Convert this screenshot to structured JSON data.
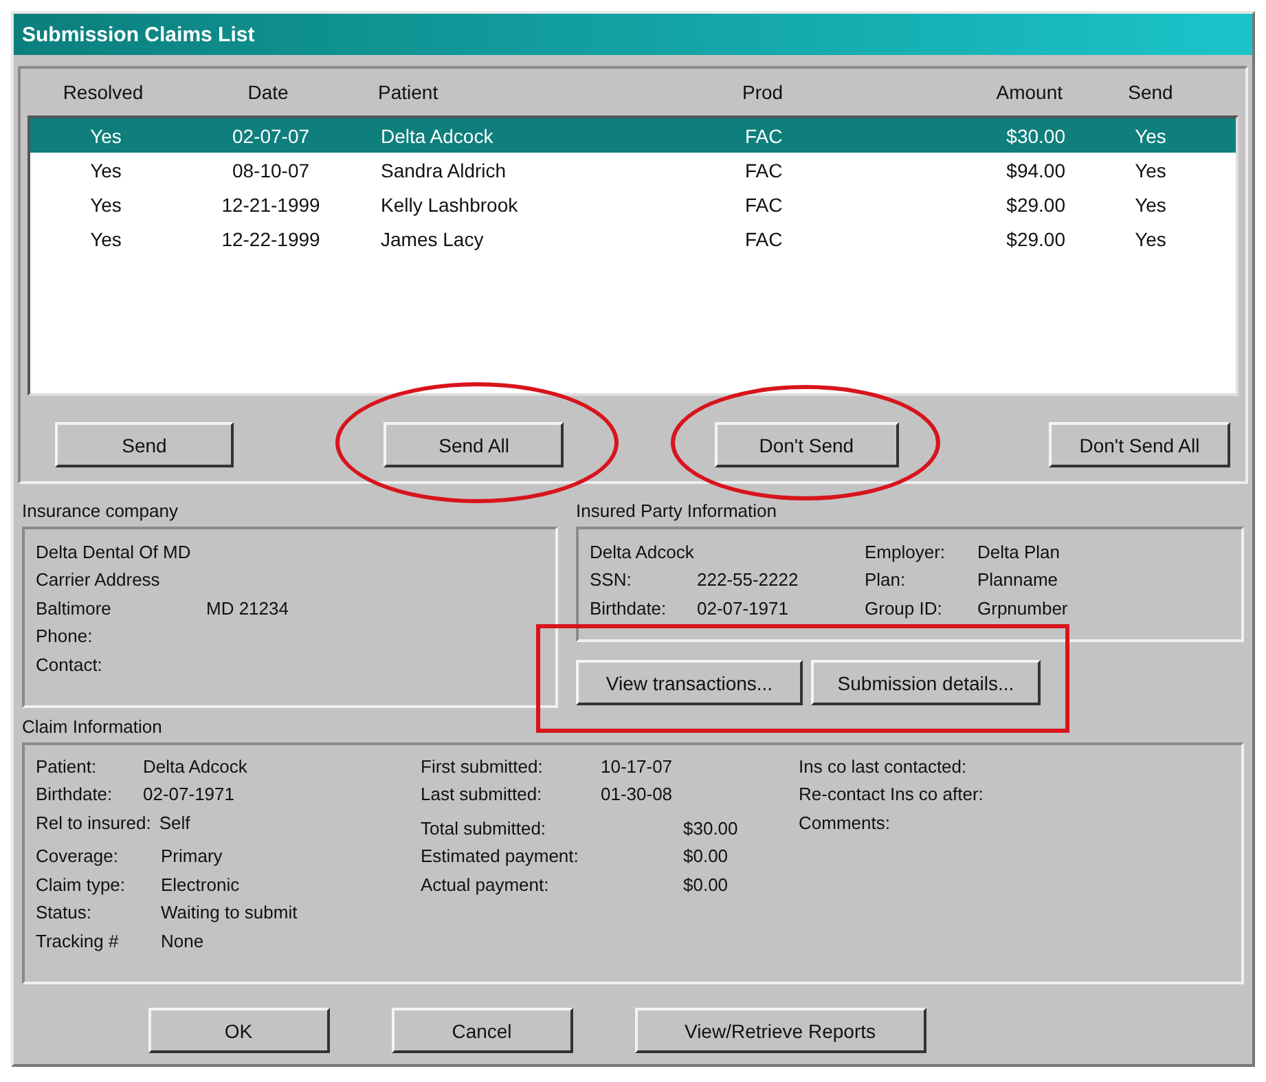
{
  "window": {
    "title": "Submission Claims List"
  },
  "claims_table": {
    "columns": [
      "Resolved",
      "Date",
      "Patient",
      "Prod",
      "Amount",
      "Send"
    ],
    "rows": [
      {
        "cells": [
          "Yes",
          "02-07-07",
          "Delta Adcock",
          "FAC",
          "$30.00",
          "Yes"
        ],
        "selected": true
      },
      {
        "cells": [
          "Yes",
          "08-10-07",
          "Sandra Aldrich",
          "FAC",
          "$94.00",
          "Yes"
        ],
        "selected": false
      },
      {
        "cells": [
          "Yes",
          "12-21-1999",
          "Kelly Lashbrook",
          "FAC",
          "$29.00",
          "Yes"
        ],
        "selected": false
      },
      {
        "cells": [
          "Yes",
          "12-22-1999",
          "James Lacy",
          "FAC",
          "$29.00",
          "Yes"
        ],
        "selected": false
      }
    ]
  },
  "list_buttons": [
    "Send",
    "Send All",
    "Don't Send",
    "Don't Send All"
  ],
  "insurance_company": {
    "heading": "Insurance company",
    "lines": [
      [
        "Delta Dental Of MD"
      ],
      [
        "Carrier Address"
      ],
      [
        "Baltimore",
        "MD  21234"
      ],
      [
        "Phone:"
      ],
      [
        "Contact:"
      ]
    ]
  },
  "insured_party": {
    "heading": "Insured Party Information",
    "left": [
      {
        "value": "Delta Adcock"
      },
      {
        "label": "SSN:",
        "value": "222-55-2222"
      },
      {
        "label": "Birthdate:",
        "value": "02-07-1971"
      }
    ],
    "right": [
      {
        "label": "Employer:",
        "value": "Delta Plan"
      },
      {
        "label": "Plan:",
        "value": "Planname"
      },
      {
        "label": "Group ID:",
        "value": "Grpnumber"
      }
    ],
    "buttons": [
      "View transactions...",
      "Submission details..."
    ]
  },
  "claim_information": {
    "heading": "Claim Information",
    "columns": [
      [
        [
          {
            "label": "Patient:",
            "value": "Delta Adcock"
          },
          {
            "label": "Birthdate:",
            "value": "02-07-1971"
          },
          {
            "label": "Rel to insured:",
            "value": "Self"
          }
        ],
        [
          {
            "label": "Coverage:",
            "value": "Primary"
          },
          {
            "label": "Claim type:",
            "value": "Electronic"
          },
          {
            "label": "Status:",
            "value": "Waiting to submit"
          },
          {
            "label": "Tracking #",
            "value": "None"
          }
        ]
      ],
      [
        [
          {
            "label": "First submitted:",
            "value": "10-17-07"
          },
          {
            "label": "Last submitted:",
            "value": "01-30-08"
          }
        ],
        [
          {
            "label": "Total submitted:",
            "value": "$30.00"
          },
          {
            "label": "Estimated payment:",
            "value": "$0.00"
          },
          {
            "label": "Actual payment:",
            "value": "$0.00"
          }
        ]
      ],
      [
        [
          {
            "label": "Ins co last contacted:"
          },
          {
            "label": "Re-contact Ins co after:"
          },
          {
            "label": "Comments:"
          }
        ]
      ]
    ]
  },
  "dialog_buttons": [
    "OK",
    "Cancel",
    "View/Retrieve Reports"
  ],
  "annotations": [
    {
      "kind": "ellipse"
    },
    {
      "kind": "ellipse"
    },
    {
      "kind": "rectangle"
    }
  ]
}
